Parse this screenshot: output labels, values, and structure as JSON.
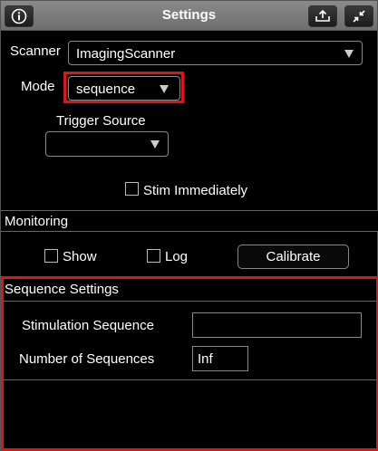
{
  "window": {
    "title": "Settings"
  },
  "scanner": {
    "label": "Scanner",
    "value": "ImagingScanner"
  },
  "mode": {
    "label": "Mode",
    "value": "sequence"
  },
  "trigger": {
    "label": "Trigger Source",
    "value": ""
  },
  "stim": {
    "label": "Stim Immediately",
    "checked": false
  },
  "monitoring": {
    "header": "Monitoring",
    "show_label": "Show",
    "log_label": "Log",
    "calibrate_label": "Calibrate"
  },
  "sequence": {
    "header": "Sequence Settings",
    "stim_seq_label": "Stimulation Sequence",
    "stim_seq_value": "",
    "num_seq_label": "Number of Sequences",
    "num_seq_value": "Inf"
  },
  "colors": {
    "highlight": "#e0121c",
    "titlebar": "#7c7c7c",
    "background": "#000000"
  }
}
